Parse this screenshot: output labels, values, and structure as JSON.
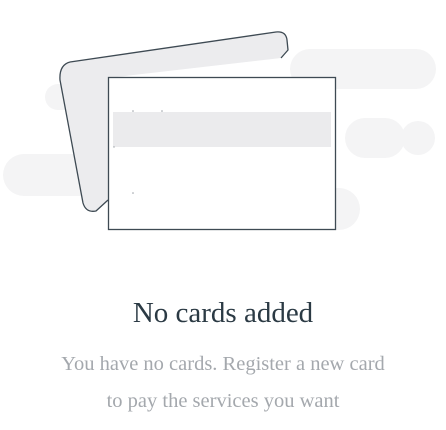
{
  "empty_state": {
    "title": "No cards added",
    "description_line1": "You have no cards. Register a new card",
    "description_line2": "to pay the services you want",
    "illustration": {
      "icon": "empty-cards-illustration",
      "colors": {
        "background_shape": "#f4f4f5",
        "card_fill_light": "#ececee",
        "card_stroke": "#3e4a53",
        "card_front_fill": "#ffffff",
        "card_stripe": "#ebebed"
      }
    },
    "colors": {
      "title": "#2b3a44",
      "description": "#a4a8ad",
      "background": "#ffffff"
    }
  }
}
